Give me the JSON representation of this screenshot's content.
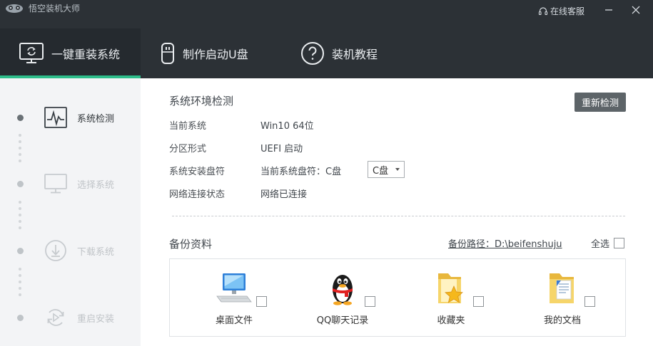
{
  "app": {
    "title": "悟空装机大师",
    "service_label": "在线客服"
  },
  "nav": {
    "tabs": [
      {
        "label": "一键重装系统"
      },
      {
        "label": "制作启动U盘"
      },
      {
        "label": "装机教程"
      }
    ]
  },
  "steps": [
    {
      "label": "系统检测"
    },
    {
      "label": "选择系统"
    },
    {
      "label": "下载系统"
    },
    {
      "label": "重启安装"
    }
  ],
  "env_check": {
    "title": "系统环境检测",
    "recheck_label": "重新检测",
    "rows": [
      {
        "label": "当前系统",
        "value": "Win10 64位"
      },
      {
        "label": "分区形式",
        "value": "UEFI 启动"
      },
      {
        "label": "系统安装盘符",
        "value": "当前系统盘符：C盘"
      },
      {
        "label": "网络连接状态",
        "value": "网络已连接"
      }
    ],
    "drive_select": {
      "selected": "C盘"
    }
  },
  "backup": {
    "title": "备份资料",
    "path_label": "备份路径：D:\\beifenshuju",
    "select_all_label": "全选",
    "items": [
      {
        "label": "桌面文件",
        "icon": "computer-icon"
      },
      {
        "label": "QQ聊天记录",
        "icon": "qq-penguin-icon"
      },
      {
        "label": "收藏夹",
        "icon": "favorites-folder-icon"
      },
      {
        "label": "我的文档",
        "icon": "documents-folder-icon"
      }
    ]
  },
  "colors": {
    "topbar": "#2c3136",
    "active_tab": "#252a2f",
    "accent_green": "#2dbd8a",
    "sidebar": "#f3f4f6",
    "button": "#5d6468"
  }
}
